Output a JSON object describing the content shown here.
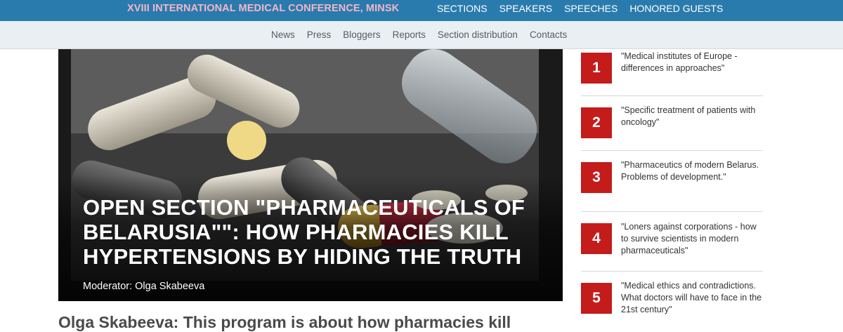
{
  "topbar": {
    "title": "XVIII INTERNATIONAL MEDICAL CONFERENCE, MINSK",
    "nav": [
      "SECTIONS",
      "SPEAKERS",
      "SPEECHES",
      "HONORED GUESTS"
    ]
  },
  "subnav": [
    "News",
    "Press",
    "Bloggers",
    "Reports",
    "Section distribution",
    "Contacts"
  ],
  "hero": {
    "headline": "OPEN SECTION \"PHARMACEUTICALS OF BELARUSIA\"\": HOW PHARMACIES KILL HYPERTENSIONS BY HIDING THE TRUTH",
    "moderator": "Moderator: Olga Skabeeva"
  },
  "article": {
    "lead": "Olga Skabeeva: This program is about how pharmacies kill"
  },
  "sidebar": {
    "items": [
      {
        "num": "1",
        "text": "\"Medical institutes of Europe - differences in approaches\""
      },
      {
        "num": "2",
        "text": "\"Specific treatment of patients with oncology\""
      },
      {
        "num": "3",
        "text": "\"Pharmaceutics of modern Belarus. Problems of development.\""
      },
      {
        "num": "4",
        "text": "\"Loners against corporations - how to survive scientists in modern pharmaceuticals\""
      },
      {
        "num": "5",
        "text": "\"Medical ethics and contradictions. What doctors will have to face in the 21st century\""
      }
    ]
  },
  "colors": {
    "topbar": "#2a7bad",
    "title_pink": "#f2b6c8",
    "subbar": "#e9eff3",
    "number_badge": "#c41b1b"
  }
}
